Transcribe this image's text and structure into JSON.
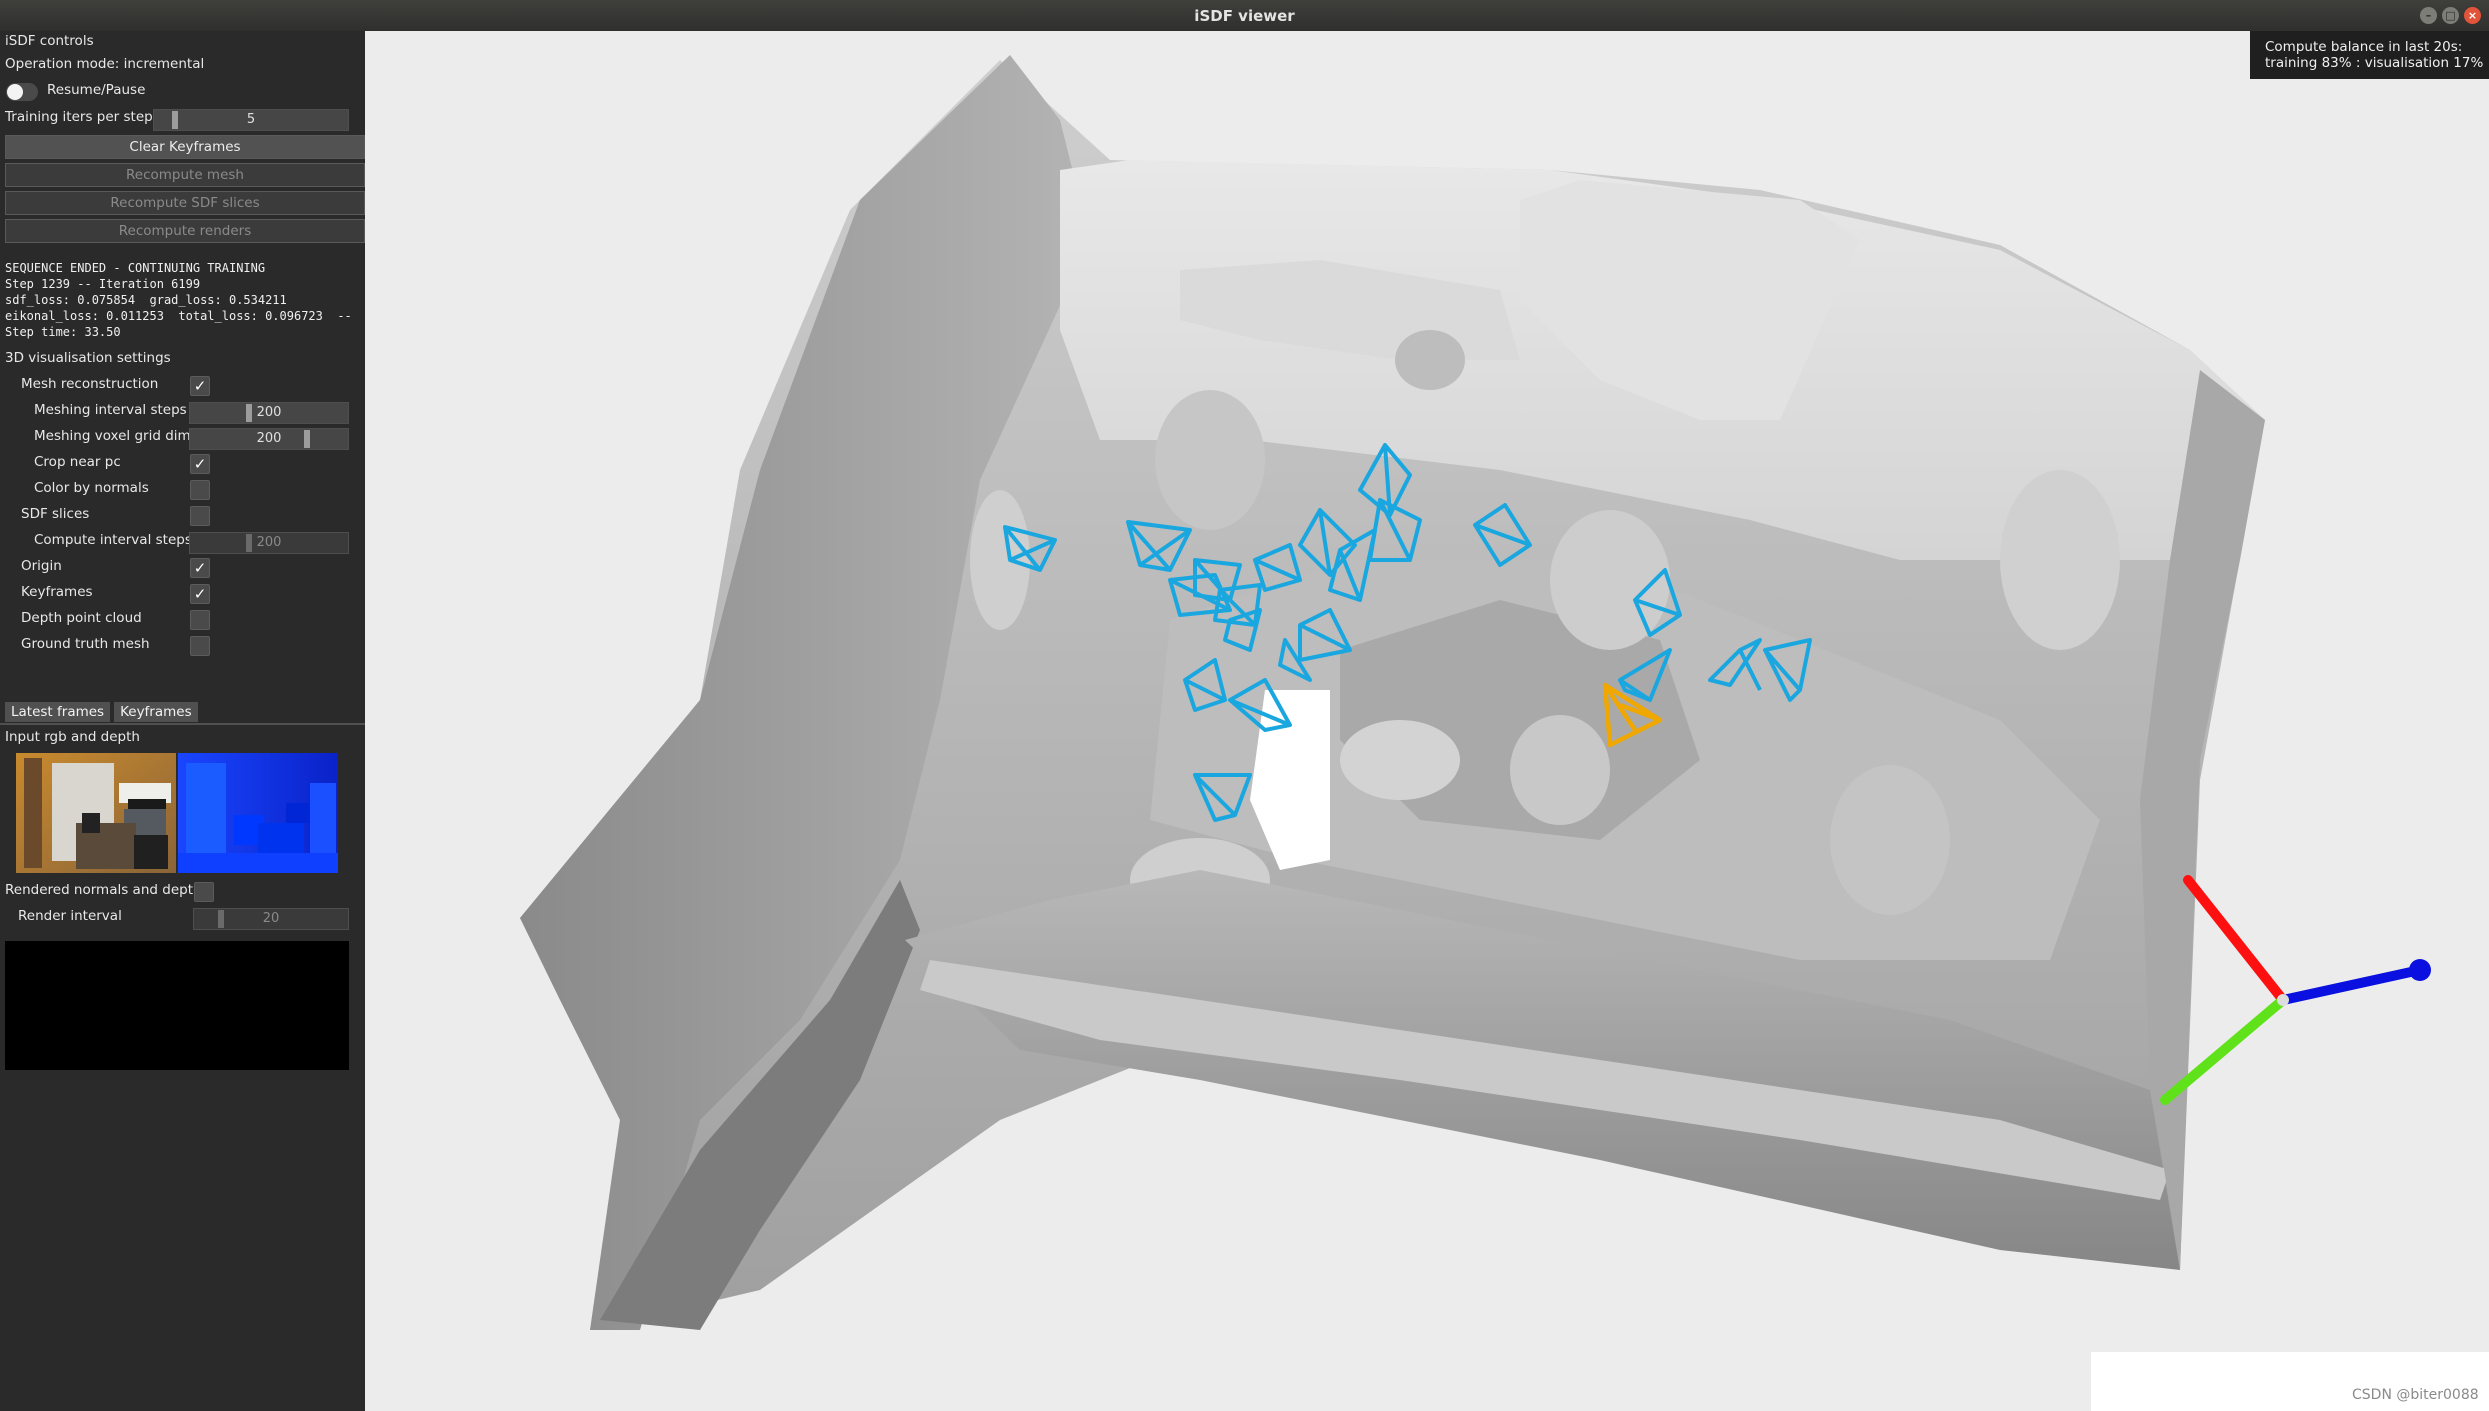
{
  "window": {
    "title": "iSDF viewer",
    "buttons": [
      "minimize",
      "maximize",
      "close"
    ]
  },
  "controls": {
    "title": "iSDF controls",
    "operation_mode": "Operation mode: incremental",
    "resume_pause": {
      "label": "Resume/Pause",
      "on": false
    },
    "training_iters": {
      "label": "Training iters per step",
      "value": "5"
    },
    "buttons": {
      "clear_keyframes": "Clear Keyframes",
      "recompute_mesh": "Recompute mesh",
      "recompute_sdf": "Recompute SDF slices",
      "recompute_renders": "Recompute renders"
    },
    "status_lines": [
      "SEQUENCE ENDED - CONTINUING TRAINING",
      "Step 1239 -- Iteration 6199",
      "sdf_loss: 0.075854  grad_loss: 0.534211",
      "eikonal_loss: 0.011253  total_loss: 0.096723  --",
      "Step time: 33.50"
    ],
    "vis_settings": {
      "title": "3D visualisation settings",
      "mesh_reconstruction": {
        "label": "Mesh reconstruction",
        "checked": true
      },
      "meshing_interval": {
        "label": "Meshing interval steps",
        "value": "200"
      },
      "meshing_voxel": {
        "label": "Meshing voxel grid dim",
        "value": "200"
      },
      "crop_near_pc": {
        "label": "Crop near pc",
        "checked": true
      },
      "color_by_normals": {
        "label": "Color by normals",
        "checked": false
      },
      "sdf_slices": {
        "label": "SDF slices",
        "checked": false
      },
      "compute_interval": {
        "label": "Compute interval steps",
        "value": "200"
      },
      "origin": {
        "label": "Origin",
        "checked": true
      },
      "keyframes": {
        "label": "Keyframes",
        "checked": true
      },
      "depth_point_cloud": {
        "label": "Depth point cloud",
        "checked": false
      },
      "ground_truth_mesh": {
        "label": "Ground truth mesh",
        "checked": false
      }
    },
    "tabs": {
      "latest": "Latest frames",
      "keyframes": "Keyframes"
    },
    "input_label": "Input rgb and depth",
    "rendered_label": "Rendered normals and depth",
    "render_interval": {
      "label": "Render interval",
      "value": "20"
    },
    "check_mark": "✓"
  },
  "viewport": {
    "balance_line1": "Compute balance in last 20s:",
    "balance_line2": "training 83% : visualisation 17%",
    "watermark": "CSDN @biter0088",
    "colors": {
      "keyframe": "#1aa7e0",
      "current_frame": "#f0a800",
      "axis_x": "#ff1010",
      "axis_y": "#5fe21a",
      "axis_z": "#0a10e0"
    }
  }
}
